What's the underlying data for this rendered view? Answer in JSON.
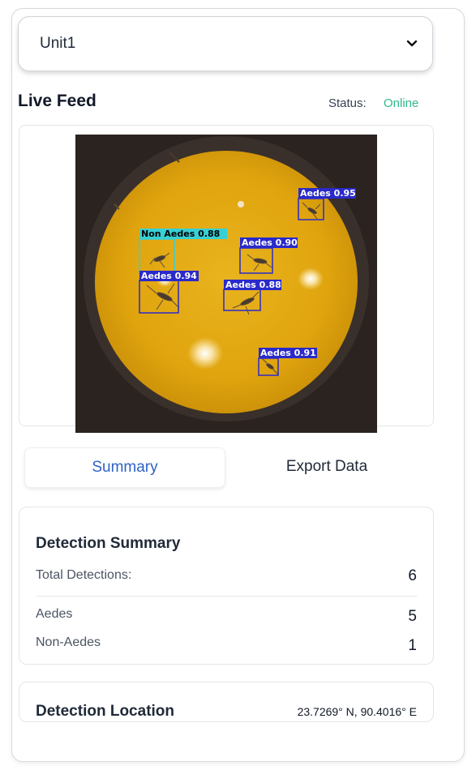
{
  "unit_select": {
    "value": "Unit1",
    "icon": "chevron-down-icon"
  },
  "live_feed": {
    "title": "Live Feed",
    "status_label": "Status:",
    "status_value": "Online",
    "status_color": "#2fb889",
    "detections": [
      {
        "label": "Aedes 0.95",
        "class": "Aedes",
        "color": "#2a2acb"
      },
      {
        "label": "Non Aedes 0.88",
        "class": "Non Aedes",
        "color": "#36d0d6"
      },
      {
        "label": "Aedes 0.90",
        "class": "Aedes",
        "color": "#2a2acb"
      },
      {
        "label": "Aedes 0.94",
        "class": "Aedes",
        "color": "#2a2acb"
      },
      {
        "label": "Aedes 0.88",
        "class": "Aedes",
        "color": "#2a2acb"
      },
      {
        "label": "Aedes 0.91",
        "class": "Aedes",
        "color": "#2a2acb"
      }
    ]
  },
  "tabs": {
    "summary": "Summary",
    "export": "Export Data",
    "active_color": "#2f63c6"
  },
  "detection_summary": {
    "title": "Detection Summary",
    "total_label": "Total Detections:",
    "total_value": "6",
    "aedes_label": "Aedes",
    "aedes_value": "5",
    "non_aedes_label": "Non-Aedes",
    "non_aedes_value": "1"
  },
  "detection_location": {
    "title": "Detection Location",
    "value": "23.7269° N, 90.4016° E"
  }
}
